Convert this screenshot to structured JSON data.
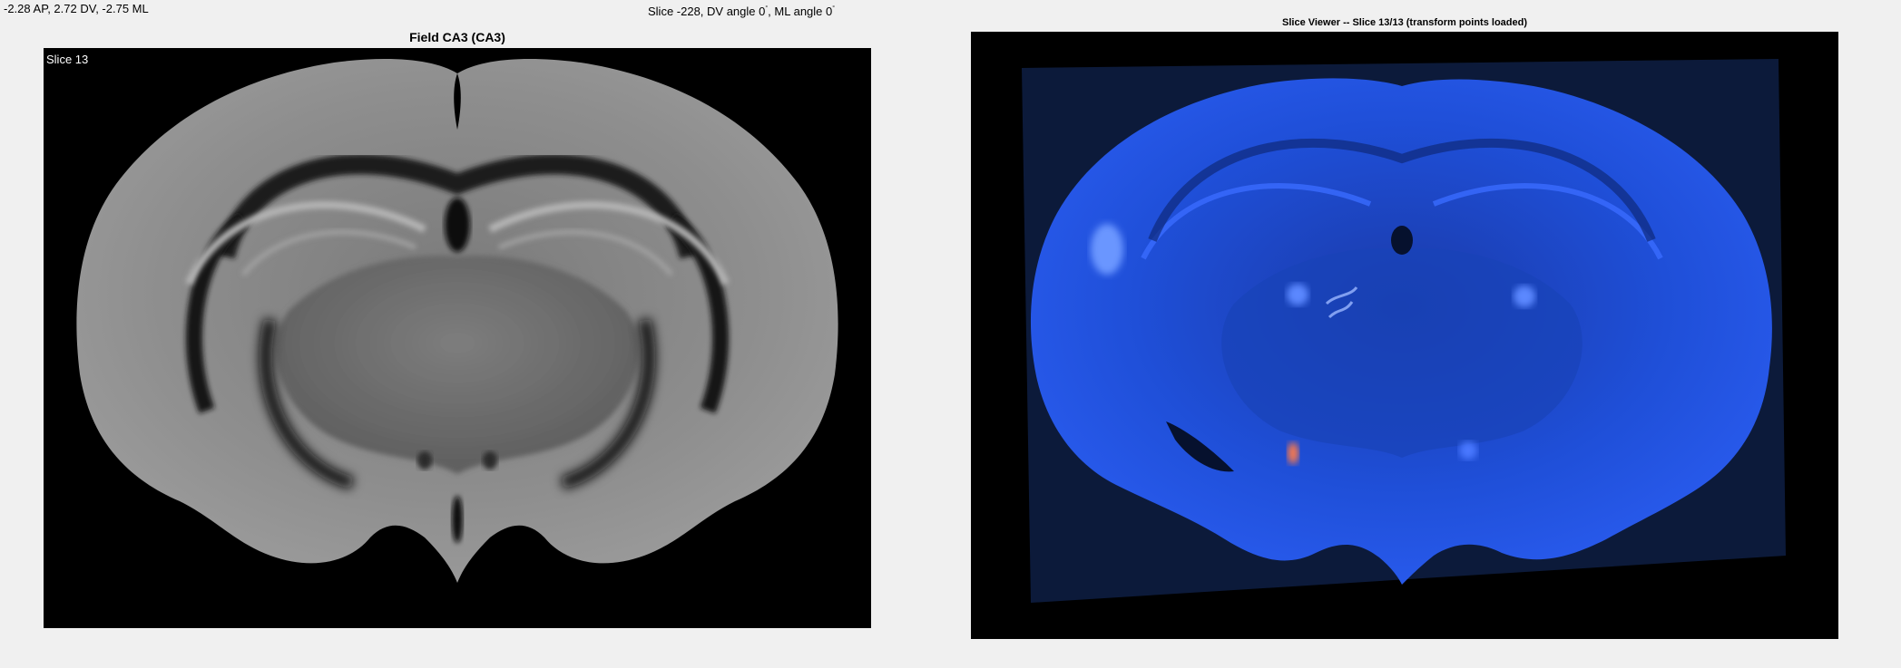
{
  "status": {
    "coordinates": "-2.28 AP, 2.72 DV, -2.75 ML",
    "slice_prefix": "Slice -228, DV angle 0",
    "degree_mark": "°",
    "ml_part": ", ML angle 0"
  },
  "atlas_view": {
    "title": "Field CA3 (CA3)",
    "overlay_label": "Slice 13"
  },
  "slice_viewer": {
    "title": "Slice Viewer -- Slice 13/13 (transform points loaded)"
  },
  "colors": {
    "figure_bg": "#f0f0f0",
    "axes_bg": "#000000",
    "atlas_tissue": "#8a8a8a",
    "histology_stain": "#1f4fd8",
    "histology_hotspot": "#ff7a4a"
  }
}
